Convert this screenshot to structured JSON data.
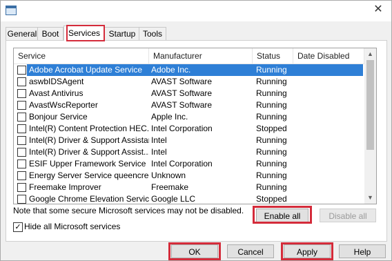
{
  "window": {
    "title": ""
  },
  "tabs": [
    "General",
    "Boot",
    "Services",
    "Startup",
    "Tools"
  ],
  "active_tab": "Services",
  "columns": [
    "Service",
    "Manufacturer",
    "Status",
    "Date Disabled"
  ],
  "rows": [
    {
      "service": "Adobe Acrobat Update Service",
      "manufacturer": "Adobe Inc.",
      "status": "Running",
      "selected": true
    },
    {
      "service": "aswbIDSAgent",
      "manufacturer": "AVAST Software",
      "status": "Running"
    },
    {
      "service": "Avast Antivirus",
      "manufacturer": "AVAST Software",
      "status": "Running"
    },
    {
      "service": "AvastWscReporter",
      "manufacturer": "AVAST Software",
      "status": "Running"
    },
    {
      "service": "Bonjour Service",
      "manufacturer": "Apple Inc.",
      "status": "Running"
    },
    {
      "service": "Intel(R) Content Protection HEC...",
      "manufacturer": "Intel Corporation",
      "status": "Stopped"
    },
    {
      "service": "Intel(R) Driver & Support Assistant",
      "manufacturer": "Intel",
      "status": "Running"
    },
    {
      "service": "Intel(R) Driver & Support Assist...",
      "manufacturer": "Intel",
      "status": "Running"
    },
    {
      "service": "ESIF Upper Framework Service",
      "manufacturer": "Intel Corporation",
      "status": "Running"
    },
    {
      "service": "Energy Server Service queencreek",
      "manufacturer": "Unknown",
      "status": "Running"
    },
    {
      "service": "Freemake Improver",
      "manufacturer": "Freemake",
      "status": "Running"
    },
    {
      "service": "Google Chrome Elevation Service",
      "manufacturer": "Google LLC",
      "status": "Stopped"
    }
  ],
  "note": "Note that some secure Microsoft services may not be disabled.",
  "buttons": {
    "enable_all": "Enable all",
    "disable_all": "Disable all",
    "ok": "OK",
    "cancel": "Cancel",
    "apply": "Apply",
    "help": "Help"
  },
  "hide_ms": {
    "label": "Hide all Microsoft services",
    "checked": true,
    "check_glyph": "✓"
  },
  "glyphs": {
    "close": "✕",
    "scroll_up": "▲",
    "scroll_down": "▼"
  },
  "colors": {
    "highlight": "#d42b3a",
    "selection": "#2e7fd6"
  }
}
